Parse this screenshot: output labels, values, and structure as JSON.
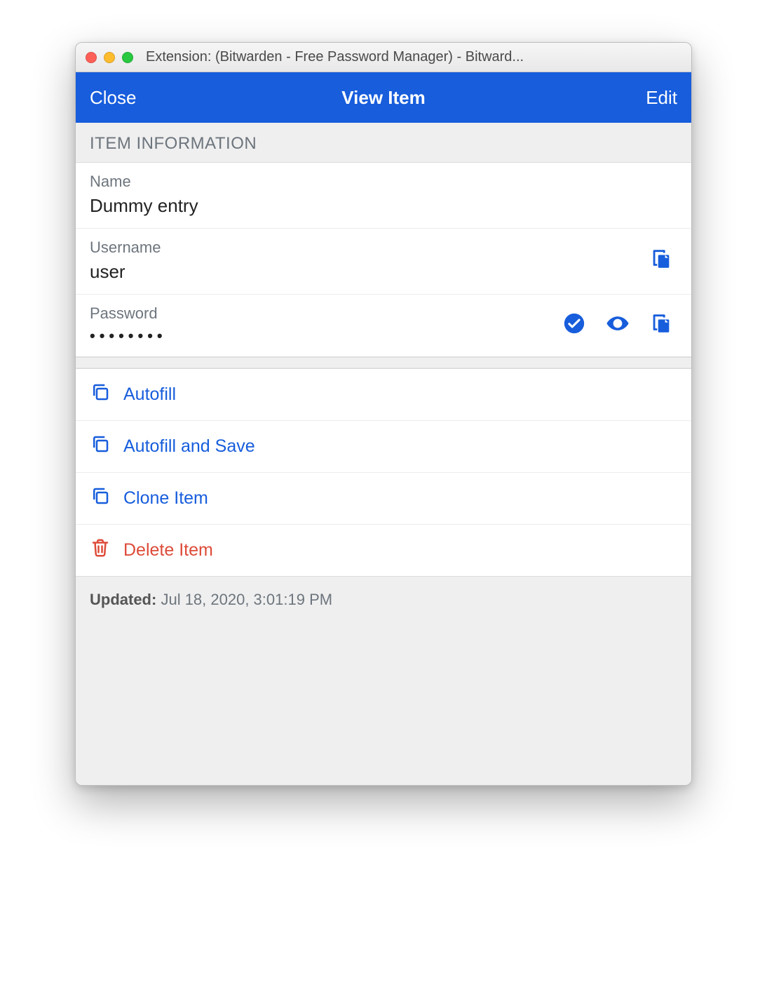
{
  "window": {
    "title": "Extension: (Bitwarden - Free Password Manager) - Bitward..."
  },
  "header": {
    "close": "Close",
    "title": "View Item",
    "edit": "Edit"
  },
  "section_label": "ITEM INFORMATION",
  "fields": {
    "name_label": "Name",
    "name_value": "Dummy entry",
    "username_label": "Username",
    "username_value": "user",
    "password_label": "Password",
    "password_masked": "••••••••"
  },
  "actions": {
    "autofill": "Autofill",
    "autofill_save": "Autofill and Save",
    "clone": "Clone Item",
    "delete": "Delete Item"
  },
  "footer": {
    "updated_label": "Updated:",
    "updated_value": "Jul 18, 2020, 3:01:19 PM"
  },
  "icons": {
    "copy": "copy-icon",
    "check": "check-circle-icon",
    "eye": "eye-icon",
    "trash": "trash-icon",
    "clone": "clone-icon"
  },
  "colors": {
    "primary": "#175ddc",
    "danger": "#dd4b39",
    "label_gray": "#6d757d"
  }
}
